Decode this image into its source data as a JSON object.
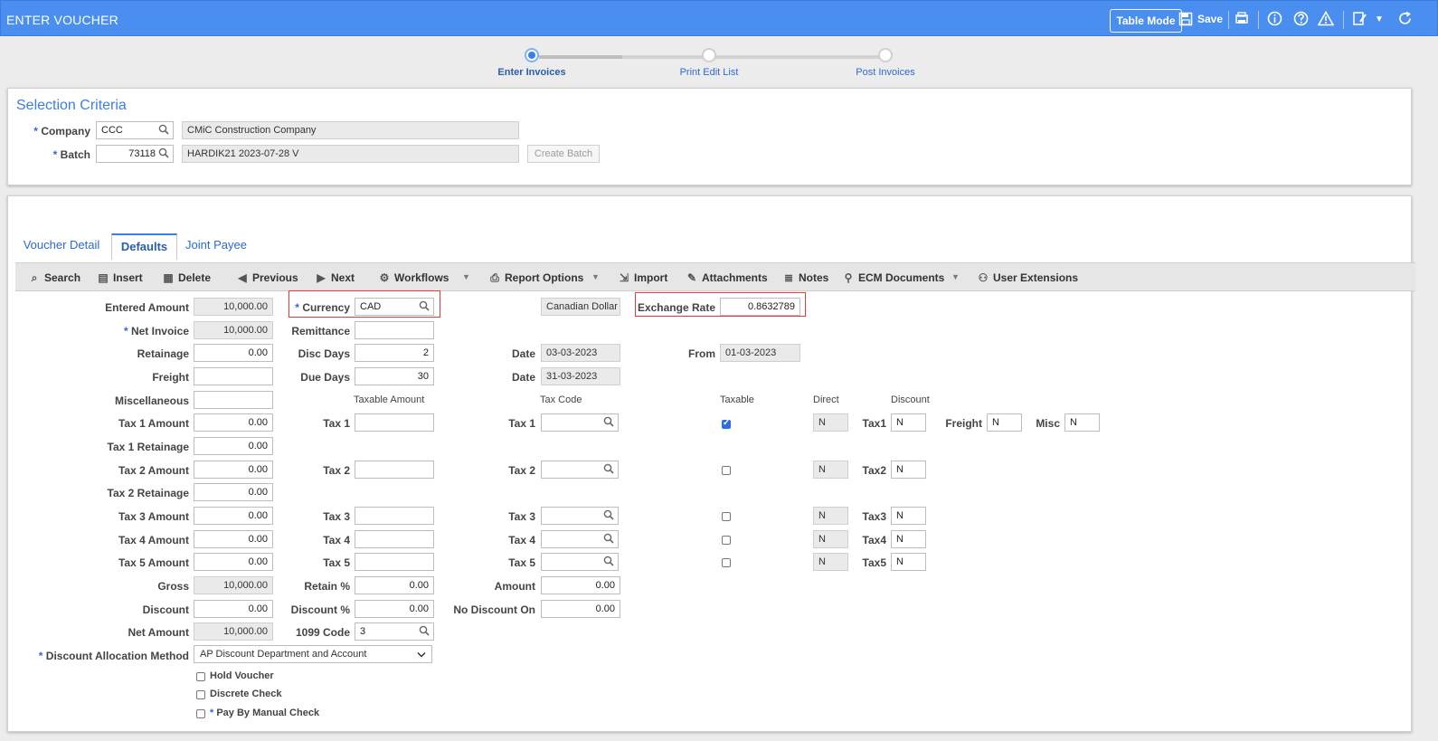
{
  "header": {
    "title": "ENTER VOUCHER",
    "table_mode": "Table Mode",
    "save": "Save",
    "accent": "#4a8ff0"
  },
  "stepper": {
    "steps": [
      {
        "label": "Enter Invoices",
        "active": true
      },
      {
        "label": "Print Edit List",
        "active": false
      },
      {
        "label": "Post Invoices",
        "active": false
      }
    ]
  },
  "selection": {
    "title": "Selection Criteria",
    "company_label": "Company",
    "company_code": "CCC",
    "company_name": "CMiC Construction Company",
    "batch_label": "Batch",
    "batch_number": "73118",
    "batch_desc": "HARDIK21 2023-07-28 V",
    "create_batch": "Create Batch"
  },
  "tabs": [
    {
      "label": "Voucher Detail",
      "active": false
    },
    {
      "label": "Defaults",
      "active": true
    },
    {
      "label": "Joint Payee",
      "active": false
    }
  ],
  "toolbar": {
    "search": "Search",
    "insert": "Insert",
    "delete": "Delete",
    "previous": "Previous",
    "next": "Next",
    "workflows": "Workflows",
    "report_options": "Report Options",
    "import": "Import",
    "attachments": "Attachments",
    "notes": "Notes",
    "ecm_documents": "ECM Documents",
    "user_extensions": "User Extensions"
  },
  "form": {
    "required_mark": "*",
    "entered_amount": {
      "label": "Entered Amount",
      "value": "10,000.00"
    },
    "net_invoice": {
      "label": "Net Invoice",
      "value": "10,000.00"
    },
    "retainage": {
      "label": "Retainage",
      "value": "0.00"
    },
    "freight": {
      "label": "Freight",
      "value": ""
    },
    "miscellaneous": {
      "label": "Miscellaneous",
      "value": ""
    },
    "tax1_amount": {
      "label": "Tax 1 Amount",
      "value": "0.00"
    },
    "tax1_retainage": {
      "label": "Tax 1 Retainage",
      "value": "0.00"
    },
    "tax2_amount": {
      "label": "Tax 2 Amount",
      "value": "0.00"
    },
    "tax2_retainage": {
      "label": "Tax 2 Retainage",
      "value": "0.00"
    },
    "tax3_amount": {
      "label": "Tax 3 Amount",
      "value": "0.00"
    },
    "tax4_amount": {
      "label": "Tax 4 Amount",
      "value": "0.00"
    },
    "tax5_amount": {
      "label": "Tax 5 Amount",
      "value": "0.00"
    },
    "gross": {
      "label": "Gross",
      "value": "10,000.00"
    },
    "discount": {
      "label": "Discount",
      "value": "0.00"
    },
    "net_amount": {
      "label": "Net Amount",
      "value": "10,000.00"
    },
    "discount_alloc": {
      "label": "Discount Allocation Method",
      "value": "AP Discount Department and Account"
    },
    "currency": {
      "label": "Currency",
      "value": "CAD",
      "name": "Canadian Dollar"
    },
    "remittance": {
      "label": "Remittance",
      "value": ""
    },
    "disc_days": {
      "label": "Disc Days",
      "value": "2"
    },
    "due_days": {
      "label": "Due Days",
      "value": "30"
    },
    "taxable_amount_head": "Taxable Amount",
    "tax_labels": [
      "Tax 1",
      "Tax 2",
      "Tax 3",
      "Tax 4",
      "Tax 5"
    ],
    "retain_pct": {
      "label": "Retain %",
      "value": "0.00"
    },
    "discount_pct": {
      "label": "Discount %",
      "value": "0.00"
    },
    "code_1099": {
      "label": "1099 Code",
      "value": "3"
    },
    "date_label": "Date",
    "disc_date": "03-03-2023",
    "due_date": "31-03-2023",
    "tax_code_head": "Tax Code",
    "amount": {
      "label": "Amount",
      "value": "0.00"
    },
    "no_discount_on": {
      "label": "No Discount On",
      "value": "0.00"
    },
    "exchange_rate": {
      "label": "Exchange Rate",
      "value": "0.8632789"
    },
    "from": {
      "label": "From",
      "value": "01-03-2023"
    },
    "taxable_head": "Taxable",
    "direct_head": "Direct",
    "discount_head": "Discount",
    "direct_values": [
      "N",
      "N",
      "N",
      "N",
      "N"
    ],
    "tax_short": [
      "Tax1",
      "Tax2",
      "Tax3",
      "Tax4",
      "Tax5"
    ],
    "discount_values": [
      "N",
      "N",
      "N",
      "N",
      "N"
    ],
    "freight_label": "Freight",
    "freight_value": "N",
    "misc_label": "Misc",
    "misc_value": "N",
    "hold_voucher": "Hold Voucher",
    "discrete_check": "Discrete Check",
    "pay_by_manual_check": "Pay By Manual Check"
  }
}
